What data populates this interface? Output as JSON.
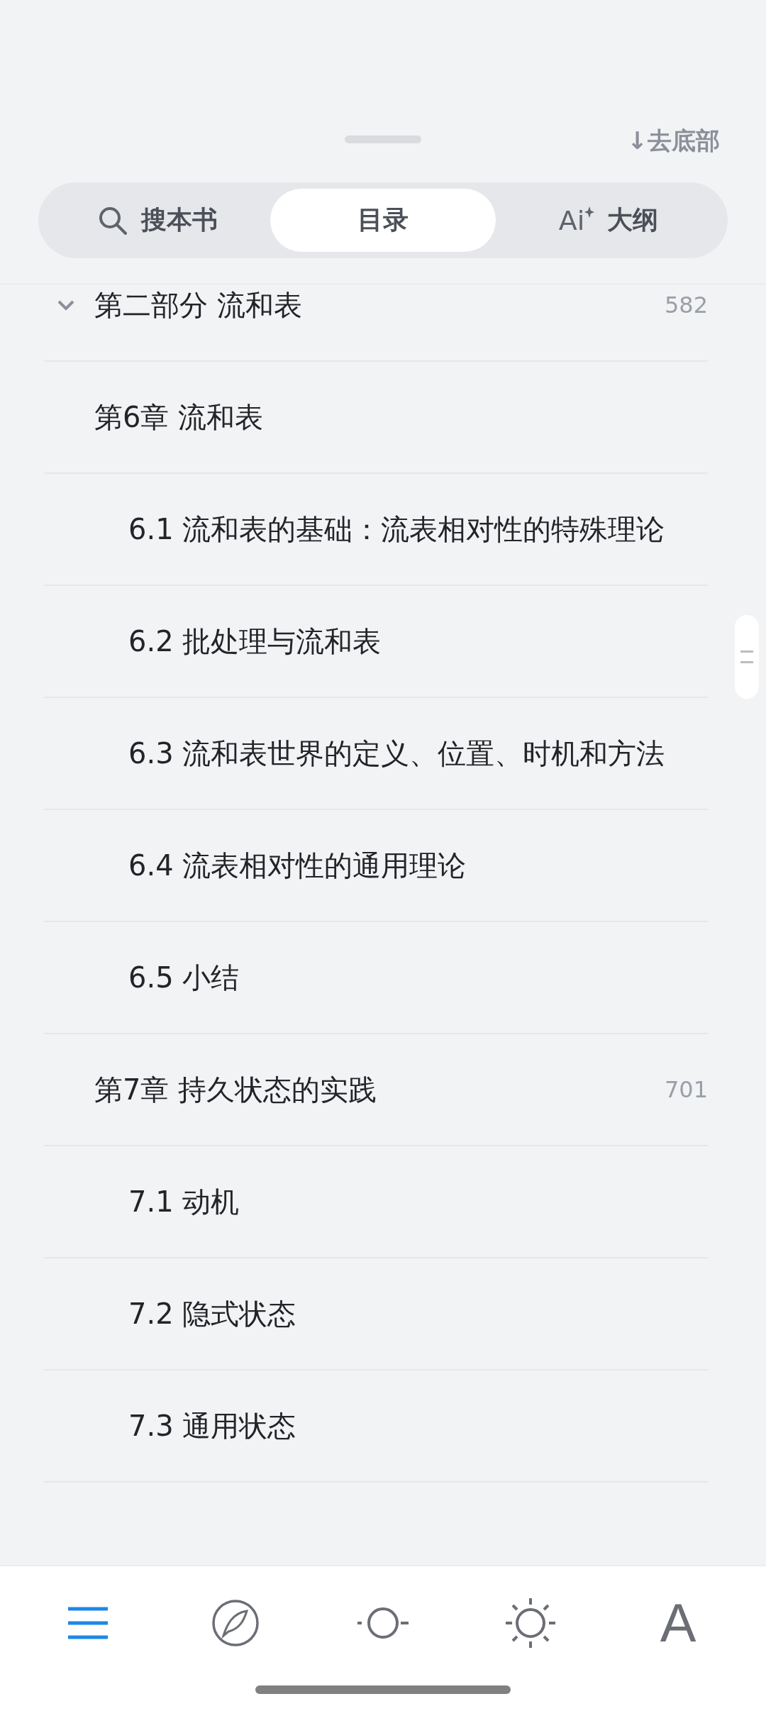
{
  "header": {
    "jump_link": "↓去底部"
  },
  "tabs": [
    {
      "kind": "search",
      "label": "搜本书",
      "selected": false
    },
    {
      "kind": "plain",
      "label": "目录",
      "selected": true
    },
    {
      "kind": "ai",
      "icon_text": "Ai",
      "label": "大纲",
      "selected": false
    }
  ],
  "outline": [
    {
      "title": "第二部分 流和表",
      "page": "582",
      "expanded": true,
      "children": [
        {
          "title": "第6章 流和表",
          "children": [
            {
              "title": "6.1 流和表的基础：流表相对性的特殊理论"
            },
            {
              "title": "6.2 批处理与流和表"
            },
            {
              "title": "6.3 流和表世界的定义、位置、时机和方法"
            },
            {
              "title": "6.4 流表相对性的通用理论"
            },
            {
              "title": "6.5 小结"
            }
          ]
        },
        {
          "title": "第7章 持久状态的实践",
          "page": "701",
          "children": [
            {
              "title": "7.1 动机"
            },
            {
              "title": "7.2 隐式状态"
            },
            {
              "title": "7.3 通用状态"
            }
          ]
        }
      ]
    }
  ],
  "toolbar": [
    {
      "kind": "menu",
      "selected": true
    },
    {
      "kind": "compass",
      "selected": false
    },
    {
      "kind": "circle",
      "selected": false
    },
    {
      "kind": "brightness",
      "selected": false
    },
    {
      "kind": "font",
      "label": "A",
      "selected": false
    }
  ]
}
